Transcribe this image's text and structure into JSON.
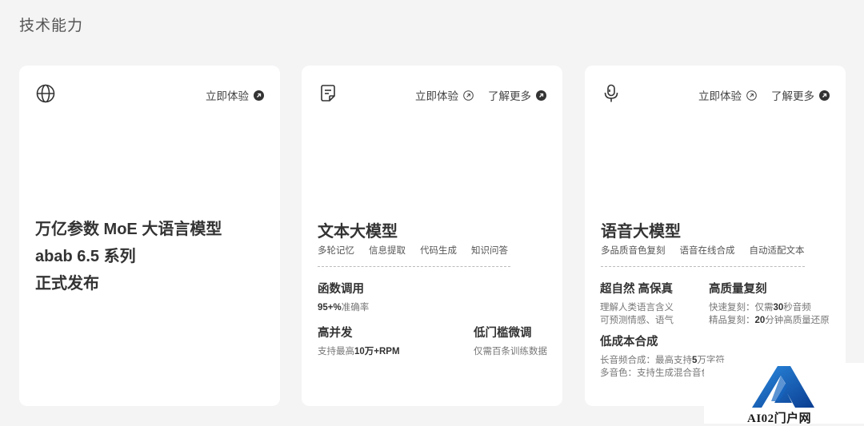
{
  "section": {
    "title": "技术能力"
  },
  "cards": [
    {
      "icon": "globe-icon",
      "actions": {
        "try": "立即体验"
      },
      "headline": [
        "万亿参数 MoE 大语言模型",
        "abab 6.5 系列",
        "正式发布"
      ]
    },
    {
      "icon": "document-edit-icon",
      "actions": {
        "try": "立即体验",
        "more": "了解更多"
      },
      "title": "文本大模型",
      "tags": [
        "多轮记忆",
        "信息提取",
        "代码生成",
        "知识问答"
      ],
      "features": [
        {
          "title": "函数调用",
          "desc_bold": "95+%",
          "desc": "准确率"
        },
        {
          "title": "高并发",
          "desc_pre": "支持最高",
          "desc_bold": "10万+RPM"
        },
        {
          "title": "低门槛微调",
          "desc": "仅需百条训练数据"
        }
      ]
    },
    {
      "icon": "microphone-icon",
      "actions": {
        "try": "立即体验",
        "more": "了解更多"
      },
      "title": "语音大模型",
      "tags": [
        "多品质音色复刻",
        "语音在线合成",
        "自动适配文本"
      ],
      "features": [
        {
          "title": "超自然 高保真",
          "lines": [
            "理解人类语言含义",
            "可预测情感、语气"
          ]
        },
        {
          "title": "高质量复刻",
          "line1_pre": "快速复刻：仅需",
          "line1_bold": "30",
          "line1_post": "秒音频",
          "line2_pre": "精品复刻：",
          "line2_bold": "20",
          "line2_post": "分钟高质量还原"
        },
        {
          "title": "低成本合成",
          "line1_pre": "长音频合成：最高支持",
          "line1_bold": "5",
          "line1_post": "万字符",
          "line2": "多音色：支持生成混合音色"
        }
      ]
    }
  ],
  "watermark": {
    "text": "AI02门户网"
  }
}
